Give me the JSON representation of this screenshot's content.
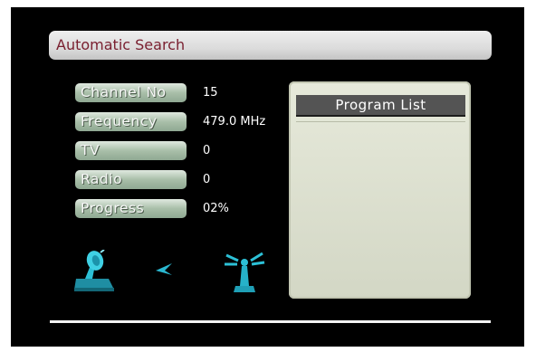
{
  "header": {
    "title": "Automatic Search"
  },
  "fields": [
    {
      "label": "Channel No",
      "value": "15"
    },
    {
      "label": "Frequency",
      "value": "479.0 MHz"
    },
    {
      "label": "TV",
      "value": "0"
    },
    {
      "label": "Radio",
      "value": "0"
    },
    {
      "label": "Progress",
      "value": "02%"
    }
  ],
  "program_list": {
    "title": "Program List",
    "items": []
  },
  "icons": [
    "satellite-dish-icon",
    "signal-arrow-icon",
    "antenna-tower-icon"
  ],
  "colors": {
    "screen_background": "#000000",
    "title_text": "#7a2030",
    "label_fill": "#a9bfa9",
    "icon_cyan": "#28b9d0"
  }
}
